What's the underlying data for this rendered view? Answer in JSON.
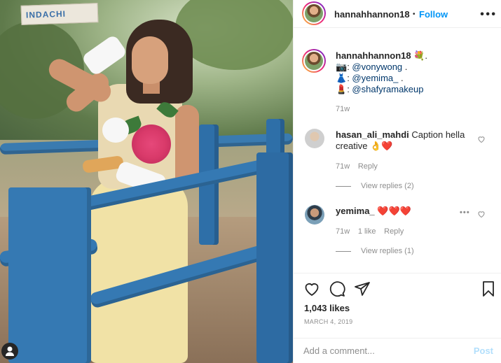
{
  "post": {
    "username": "hannahhannon18",
    "separator": "•",
    "follow_label": "Follow",
    "more_icon": "more-horizontal-icon",
    "caption": {
      "username": "hannahhannon18",
      "emoji": "💐.",
      "credits": [
        {
          "icon": "📷",
          "handle": "@vonywong",
          "suffix": " ."
        },
        {
          "icon": "👗",
          "handle": "@yemima_",
          "suffix": " ."
        },
        {
          "icon": "💄",
          "handle": "@shafyramakeup",
          "suffix": ""
        }
      ],
      "age": "71w"
    }
  },
  "comments": [
    {
      "username": "hasan_ali_mahdi",
      "text": "Caption hella creative 👌❤️",
      "age": "71w",
      "likes": "",
      "reply_label": "Reply",
      "view_replies": "View replies (2)"
    },
    {
      "username": "yemima_",
      "text": "❤️❤️❤️",
      "age": "71w",
      "likes": "1 like",
      "reply_label": "Reply",
      "view_replies": "View replies (1)"
    }
  ],
  "actions": {
    "icons": [
      "heart-icon",
      "comment-icon",
      "share-icon",
      "bookmark-icon"
    ],
    "likes": "1,043 likes",
    "date": "MARCH 4, 2019"
  },
  "comment_box": {
    "placeholder": "Add a comment...",
    "post_label": "Post"
  },
  "photo": {
    "sign_text": "INDACHI"
  },
  "colors": {
    "accent": "#0095f6",
    "mention": "#00376b",
    "muted": "#8e8e8e",
    "heart": "#ed4956",
    "post_disabled": "#b2dffc"
  }
}
